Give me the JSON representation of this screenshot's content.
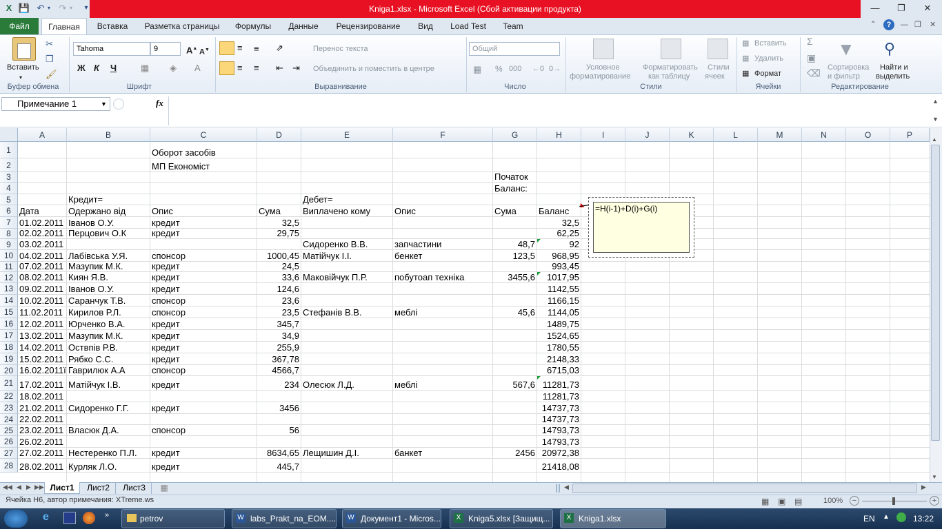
{
  "window": {
    "title": "Kniga1.xlsx  -  Microsoft Excel (Сбой активации продукта)"
  },
  "ribbon_tabs": [
    "Файл",
    "Главная",
    "Вставка",
    "Разметка страницы",
    "Формулы",
    "Данные",
    "Рецензирование",
    "Вид",
    "Load Test",
    "Team"
  ],
  "ribbon": {
    "paste": "Вставить",
    "font_name": "Tahoma",
    "font_size": "9",
    "wrap_text": "Перенос текста",
    "merge_center": "Объединить и поместить в центре",
    "number_format": "Общий",
    "cond_format": [
      "Условное",
      "форматирование"
    ],
    "format_table": [
      "Форматировать",
      "как таблицу"
    ],
    "cell_styles": [
      "Стили",
      "ячеек"
    ],
    "insert": "Вставить",
    "delete": "Удалить",
    "format": "Формат",
    "sort_filter": [
      "Сортировка",
      "и фильтр"
    ],
    "find_select": [
      "Найти и",
      "выделить"
    ],
    "groups": [
      "Буфер обмена",
      "Шрифт",
      "Выравнивание",
      "Число",
      "Стили",
      "Ячейки",
      "Редактирование"
    ],
    "bold": "Ж",
    "italic": "К",
    "underline": "Ч",
    "percent": "%",
    "thousands": "000"
  },
  "formula_bar": {
    "name_box": "Примечание 1",
    "fx": "fx",
    "formula": ""
  },
  "columns": [
    "A",
    "B",
    "C",
    "D",
    "E",
    "F",
    "G",
    "H",
    "I",
    "J",
    "K",
    "L",
    "M",
    "N",
    "O",
    "P"
  ],
  "rows": [
    {
      "n": "1",
      "A": "",
      "B": "",
      "C": "Оборот засобів",
      "D": "",
      "E": "",
      "F": "",
      "G": "",
      "H": ""
    },
    {
      "n": "2",
      "A": "",
      "B": "",
      "C": "МП Економіст",
      "D": "",
      "E": "",
      "F": "",
      "G": "",
      "H": ""
    },
    {
      "n": "3",
      "A": "",
      "B": "",
      "C": "",
      "D": "",
      "E": "",
      "F": "",
      "G": "Початок",
      "H": ""
    },
    {
      "n": "4",
      "A": "",
      "B": "",
      "C": "",
      "D": "",
      "E": "",
      "F": "",
      "G": "Баланс:",
      "H": ""
    },
    {
      "n": "5",
      "A": "",
      "B": "Кредит=",
      "C": "",
      "D": "",
      "E": "Дебет=",
      "F": "",
      "G": "",
      "H": ""
    },
    {
      "n": "6",
      "A": "Дата",
      "B": "Одержано від",
      "C": "Опис",
      "D": "Сума",
      "E": "Виплачено кому",
      "F": "Опис",
      "G": "Сума",
      "H": "Баланс"
    },
    {
      "n": "7",
      "A": "01.02.2011",
      "B": "Іванов О.У.",
      "C": "кредит",
      "D": "32,5",
      "E": "",
      "F": "",
      "G": "",
      "H": "32,5"
    },
    {
      "n": "8",
      "A": "02.02.2011",
      "B": "Перцович О.К",
      "C": "кредит",
      "D": "29,75",
      "E": "",
      "F": "",
      "G": "",
      "H": "62,25"
    },
    {
      "n": "9",
      "A": "03.02.2011",
      "B": "",
      "C": "",
      "D": "",
      "E": "Сидоренко В.В.",
      "F": "запчастини",
      "G": "48,7",
      "H": "92"
    },
    {
      "n": "10",
      "A": "04.02.2011",
      "B": "Лабівська У.Я.",
      "C": "спонсор",
      "D": "1000,45",
      "E": "Матійчук І.І.",
      "F": "бенкет",
      "G": "123,5",
      "H": "968,95"
    },
    {
      "n": "11",
      "A": "07.02.2011",
      "B": "Мазупик М.К.",
      "C": "кредит",
      "D": "24,5",
      "E": "",
      "F": "",
      "G": "",
      "H": "993,45"
    },
    {
      "n": "12",
      "A": "08.02.2011",
      "B": "Киян Я.В.",
      "C": "кредит",
      "D": "33,6",
      "E": "Маковійчук П.Р.",
      "F": "побутоап техніка",
      "G": "3455,6",
      "H": "1017,95"
    },
    {
      "n": "13",
      "A": "09.02.2011",
      "B": "Іванов О.У.",
      "C": "кредит",
      "D": "124,6",
      "E": "",
      "F": "",
      "G": "",
      "H": "1142,55"
    },
    {
      "n": "14",
      "A": "10.02.2011",
      "B": "Саранчук Т.В.",
      "C": "спонсор",
      "D": "23,6",
      "E": "",
      "F": "",
      "G": "",
      "H": "1166,15"
    },
    {
      "n": "15",
      "A": "11.02.2011",
      "B": "Кирилов Р.Л.",
      "C": "спонсор",
      "D": "23,5",
      "E": "Стефанів В.В.",
      "F": "меблі",
      "G": "45,6",
      "H": "1144,05"
    },
    {
      "n": "16",
      "A": "12.02.2011",
      "B": "Юрченко В.А.",
      "C": "кредит",
      "D": "345,7",
      "E": "",
      "F": "",
      "G": "",
      "H": "1489,75"
    },
    {
      "n": "17",
      "A": "13.02.2011",
      "B": "Мазупик М.К.",
      "C": "кредит",
      "D": "34,9",
      "E": "",
      "F": "",
      "G": "",
      "H": "1524,65"
    },
    {
      "n": "18",
      "A": "14.02.2011",
      "B": "Оствпів Р.В.",
      "C": "кредит",
      "D": "255,9",
      "E": "",
      "F": "",
      "G": "",
      "H": "1780,55"
    },
    {
      "n": "19",
      "A": "15.02.2011",
      "B": "Рябко С.С.",
      "C": "кредит",
      "D": "367,78",
      "E": "",
      "F": "",
      "G": "",
      "H": "2148,33"
    },
    {
      "n": "20",
      "A": "16.02.2011ї",
      "B": "Гаврилюк А.А",
      "C": "спонсор",
      "D": "4566,7",
      "E": "",
      "F": "",
      "G": "",
      "H": "6715,03"
    },
    {
      "n": "21",
      "A": "17.02.2011",
      "B": "Матійчук І.В.",
      "C": "кредит",
      "D": "234",
      "E": "Олесюк Л.Д.",
      "F": "меблі",
      "G": "567,6",
      "H": "11281,73"
    },
    {
      "n": "22",
      "A": "18.02.2011",
      "B": "",
      "C": "",
      "D": "",
      "E": "",
      "F": "",
      "G": "",
      "H": "11281,73"
    },
    {
      "n": "23",
      "A": "21.02.2011",
      "B": "Сидоренко Г.Г.",
      "C": "кредит",
      "D": "3456",
      "E": "",
      "F": "",
      "G": "",
      "H": "14737,73"
    },
    {
      "n": "24",
      "A": "22.02.2011",
      "B": "",
      "C": "",
      "D": "",
      "E": "",
      "F": "",
      "G": "",
      "H": "14737,73"
    },
    {
      "n": "25",
      "A": "23.02.2011",
      "B": "Власюк Д.А.",
      "C": "спонсор",
      "D": "56",
      "E": "",
      "F": "",
      "G": "",
      "H": "14793,73"
    },
    {
      "n": "26",
      "A": "26.02.2011",
      "B": "",
      "C": "",
      "D": "",
      "E": "",
      "F": "",
      "G": "",
      "H": "14793,73"
    },
    {
      "n": "27",
      "A": "27.02.2011",
      "B": "Нестеренко П.Л.",
      "C": "кредит",
      "D": "8634,65",
      "E": "Лещишин Д.І.",
      "F": "банкет",
      "G": "2456",
      "H": "20972,38"
    },
    {
      "n": "28",
      "A": "28.02.2011",
      "B": "Курляк Л.О.",
      "C": "кредит",
      "D": "445,7",
      "E": "",
      "F": "",
      "G": "",
      "H": "21418,08"
    }
  ],
  "comment": {
    "text": "=H(i-1)+D(i)+G(i)"
  },
  "sheets": [
    "Лист1",
    "Лист2",
    "Лист3"
  ],
  "status": {
    "text": "Ячейка H6, автор примечания: XTreme.ws",
    "zoom": "100%"
  },
  "taskbar": {
    "items": [
      "petrov",
      "labs_Prakt_na_EOM....",
      "Документ1 - Micros...",
      "Kniga5.xlsx  [Защищ...",
      "Kniga1.xlsx"
    ],
    "lang": "EN",
    "time": "13:22"
  }
}
